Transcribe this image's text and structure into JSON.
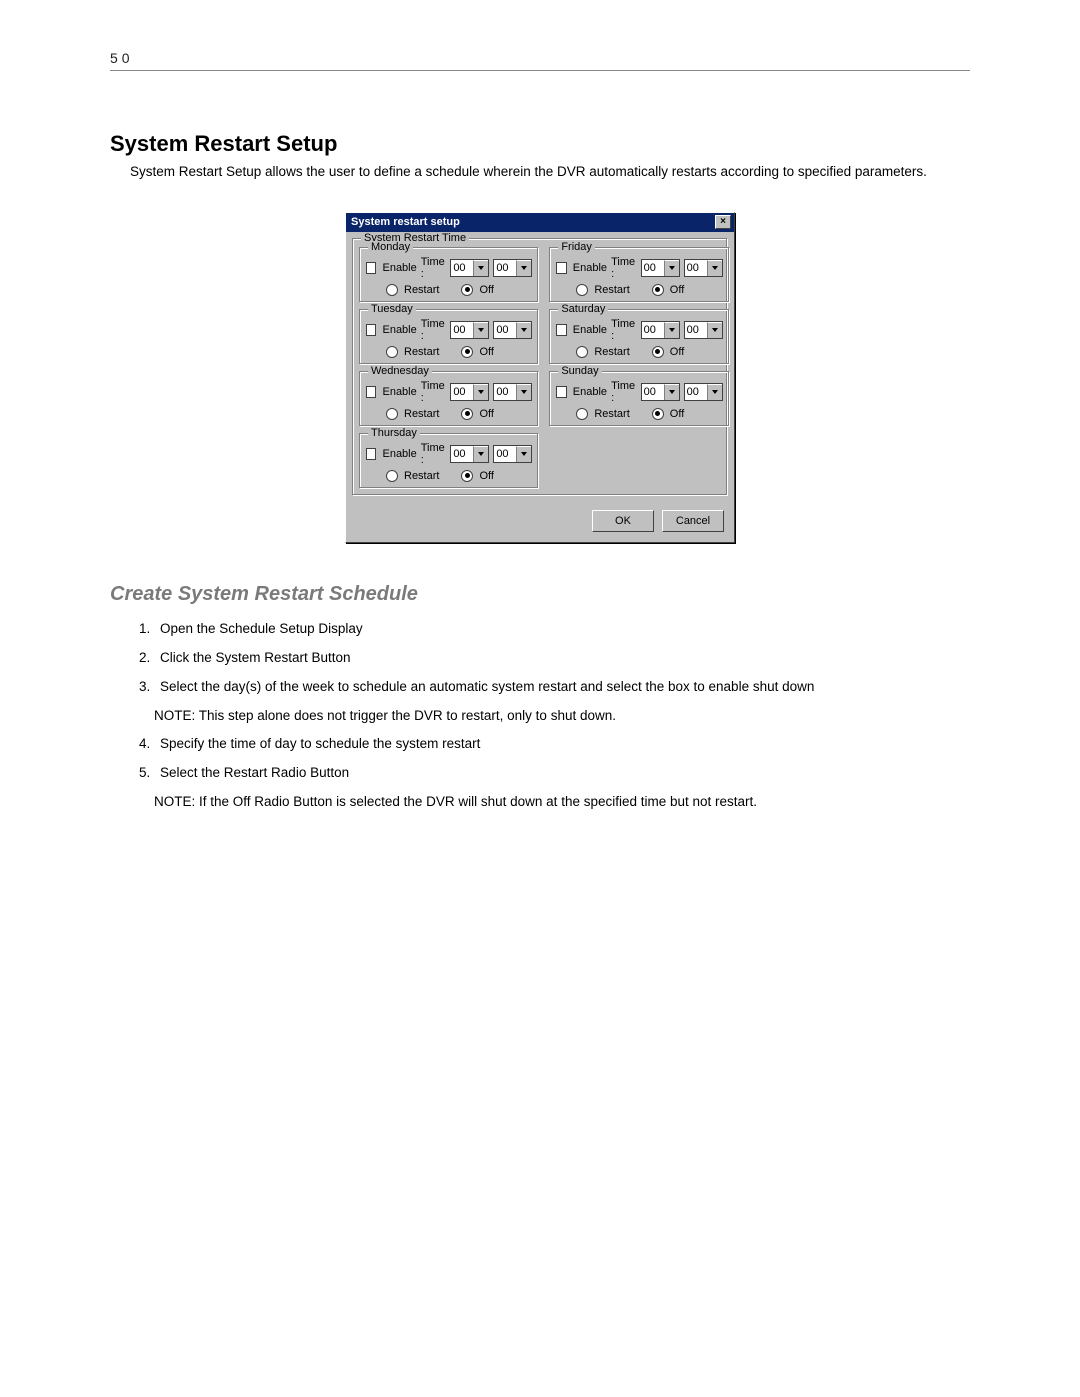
{
  "page_number": "50",
  "section_title": "System Restart Setup",
  "intro_text": "System Restart Setup allows the user to define a schedule wherein the DVR automatically restarts according to specified parameters.",
  "dialog": {
    "title": "System restart setup",
    "close_glyph": "×",
    "group_title": "System Restart Time",
    "enable_label": "Enable",
    "time_label": "Time :",
    "restart_label": "Restart",
    "off_label": "Off",
    "hour_value": "00",
    "minute_value": "00",
    "ok_label": "OK",
    "cancel_label": "Cancel",
    "days": {
      "monday": "Monday",
      "tuesday": "Tuesday",
      "wednesday": "Wednesday",
      "thursday": "Thursday",
      "friday": "Friday",
      "saturday": "Saturday",
      "sunday": "Sunday"
    }
  },
  "subsection_title": "Create System Restart Schedule",
  "steps": {
    "s1": "Open the Schedule Setup Display",
    "s2": "Click the System Restart Button",
    "s3": "Select the day(s) of the week to schedule an automatic system restart and select the box to enable shut down",
    "s4": "Specify the time of day to schedule the system restart",
    "s5": "Select the Restart Radio Button"
  },
  "note1": "NOTE: This step alone does not trigger the DVR to restart, only to shut down.",
  "note2": "NOTE: If the Off Radio Button is selected the DVR will shut down at the specified time but not restart."
}
